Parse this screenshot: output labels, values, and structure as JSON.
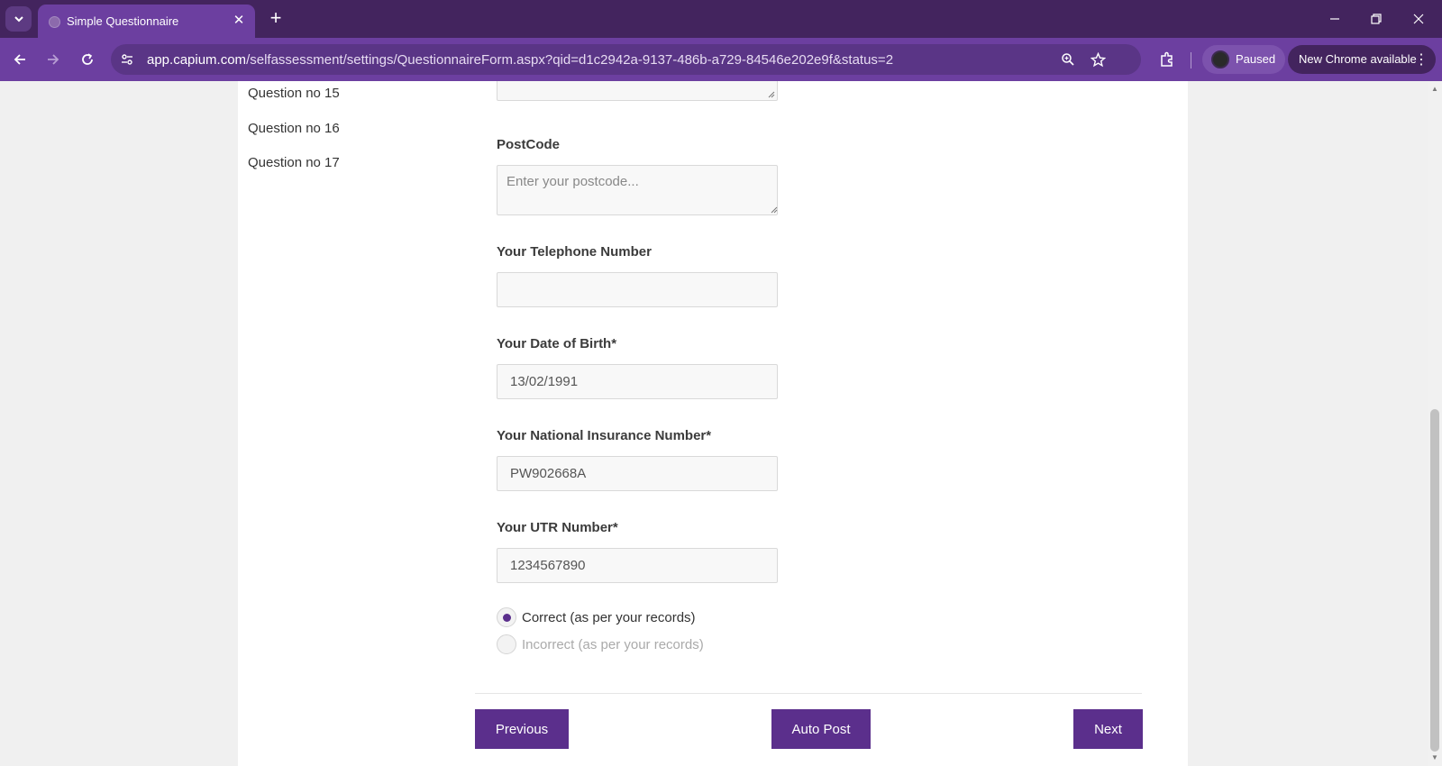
{
  "browser": {
    "tab_title": "Simple Questionnaire",
    "url_host": "app.capium.com",
    "url_path": "/selfassessment/settings/QuestionnaireForm.aspx?qid=d1c2942a-9137-486b-a729-84546e202e9f&status=2",
    "profile_status": "Paused",
    "update_label": "New Chrome available"
  },
  "question_nav": [
    {
      "label": "Question no 15"
    },
    {
      "label": "Question no 16"
    },
    {
      "label": "Question no 17"
    }
  ],
  "form": {
    "postcode": {
      "label": "PostCode",
      "placeholder": "Enter your postcode...",
      "value": ""
    },
    "telephone": {
      "label": "Your Telephone Number",
      "value": ""
    },
    "dob": {
      "label": "Your Date of Birth*",
      "value": "13/02/1991"
    },
    "ni_number": {
      "label": "Your National Insurance Number*",
      "value": "PW902668A"
    },
    "utr": {
      "label": "Your UTR Number*",
      "value": "1234567890"
    },
    "confirmation": {
      "options": [
        {
          "label": "Correct (as per your records)",
          "checked": true
        },
        {
          "label": "Incorrect (as per your records)",
          "checked": false
        }
      ]
    }
  },
  "buttons": {
    "previous": "Previous",
    "auto_post": "Auto Post",
    "next": "Next"
  },
  "colors": {
    "accent": "#5b2f8c",
    "browser_frame": "#6c3fa0",
    "tabstrip": "#43245e"
  }
}
